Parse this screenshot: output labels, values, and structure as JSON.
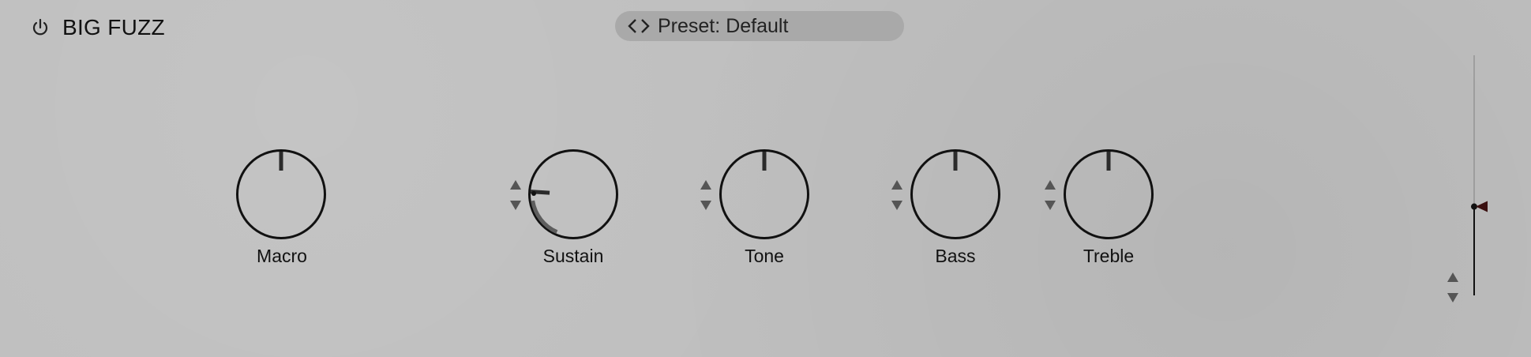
{
  "header": {
    "title": "BIG FUZZ",
    "preset_label": "Preset:",
    "preset_name": "Default"
  },
  "knobs": [
    {
      "label": "Macro",
      "value": 0.5,
      "has_stepper": false
    },
    {
      "label": "Sustain",
      "value": 0.18,
      "has_stepper": true
    },
    {
      "label": "Tone",
      "value": 0.5,
      "has_stepper": true
    },
    {
      "label": "Bass",
      "value": 0.5,
      "has_stepper": true
    },
    {
      "label": "Treble",
      "value": 0.5,
      "has_stepper": true
    }
  ],
  "fader": {
    "level": 0.37
  },
  "colors": {
    "background": "#bfbfbf",
    "preset_bar": "#a9a9a9",
    "knob_outline": "#111111",
    "knob_pointer": "#2b2b2b",
    "arc": "#5e5e5e",
    "fader_marker": "#3a1010",
    "stepper": "#555555"
  },
  "icons": {
    "power": "power-icon",
    "prev": "chevron-left-icon",
    "next": "chevron-right-icon",
    "step_up": "triangle-up-icon",
    "step_down": "triangle-down-icon"
  }
}
